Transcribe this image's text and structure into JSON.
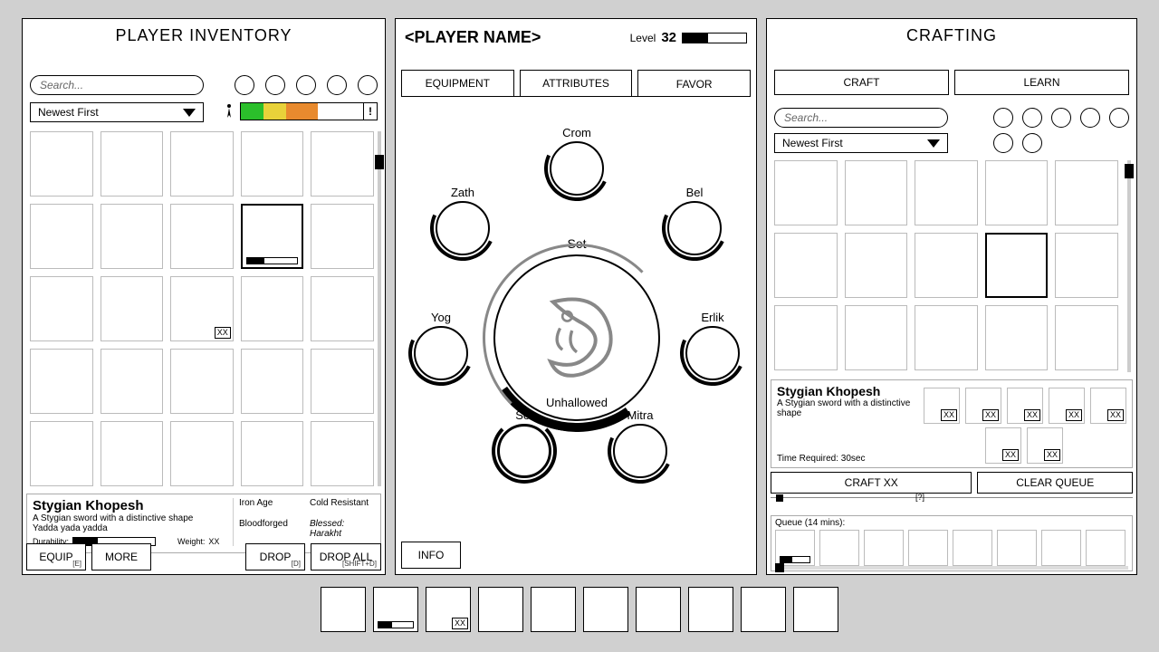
{
  "inventory": {
    "title": "PLAYER INVENTORY",
    "search_ph": "Search...",
    "sort": "Newest First",
    "slot_badge": "XX",
    "item": {
      "name": "Stygian Khopesh",
      "desc1": "A Stygian sword with a distinctive shape",
      "desc2": "Yadda yada yadda",
      "dur_label": "Durability:",
      "weight_label": "Weight:",
      "weight_val": "XX",
      "tags": [
        "Iron Age",
        "Cold Resistant",
        "Bloodforged",
        "Blessed: Harakht"
      ]
    },
    "buttons": {
      "equip": "EQUIP",
      "equip_k": "[E]",
      "more": "MORE",
      "drop": "DROP",
      "drop_k": "[D]",
      "drop_all": "DROP ALL",
      "drop_all_k": "[SHIFT+D]"
    }
  },
  "player": {
    "name": "<PLAYER NAME>",
    "level_label": "Level",
    "level": "32",
    "tabs": [
      "EQUIPMENT",
      "ATTRIBUTES",
      "FAVOR"
    ],
    "favor": {
      "center_top": "Set",
      "center_bottom": "Unhallowed",
      "nodes": [
        "Crom",
        "Bel",
        "Erlik",
        "Mitra",
        "Set",
        "Yog",
        "Zath"
      ]
    },
    "info_btn": "INFO"
  },
  "crafting": {
    "title": "CRAFTING",
    "tabs": [
      "CRAFT",
      "LEARN"
    ],
    "search_ph": "Search...",
    "sort": "Newest First",
    "item": {
      "name": "Stygian Khopesh",
      "desc": "A Stygian sword with a distinctive shape",
      "time_label": "Time Required: 30sec",
      "ing_badge": "XX"
    },
    "craft_btn": "CRAFT XX",
    "clear_btn": "CLEAR QUEUE",
    "slider_hint": "[?]",
    "queue_label": "Queue (14 mins):"
  },
  "hotbar": {
    "badge": "XX"
  }
}
